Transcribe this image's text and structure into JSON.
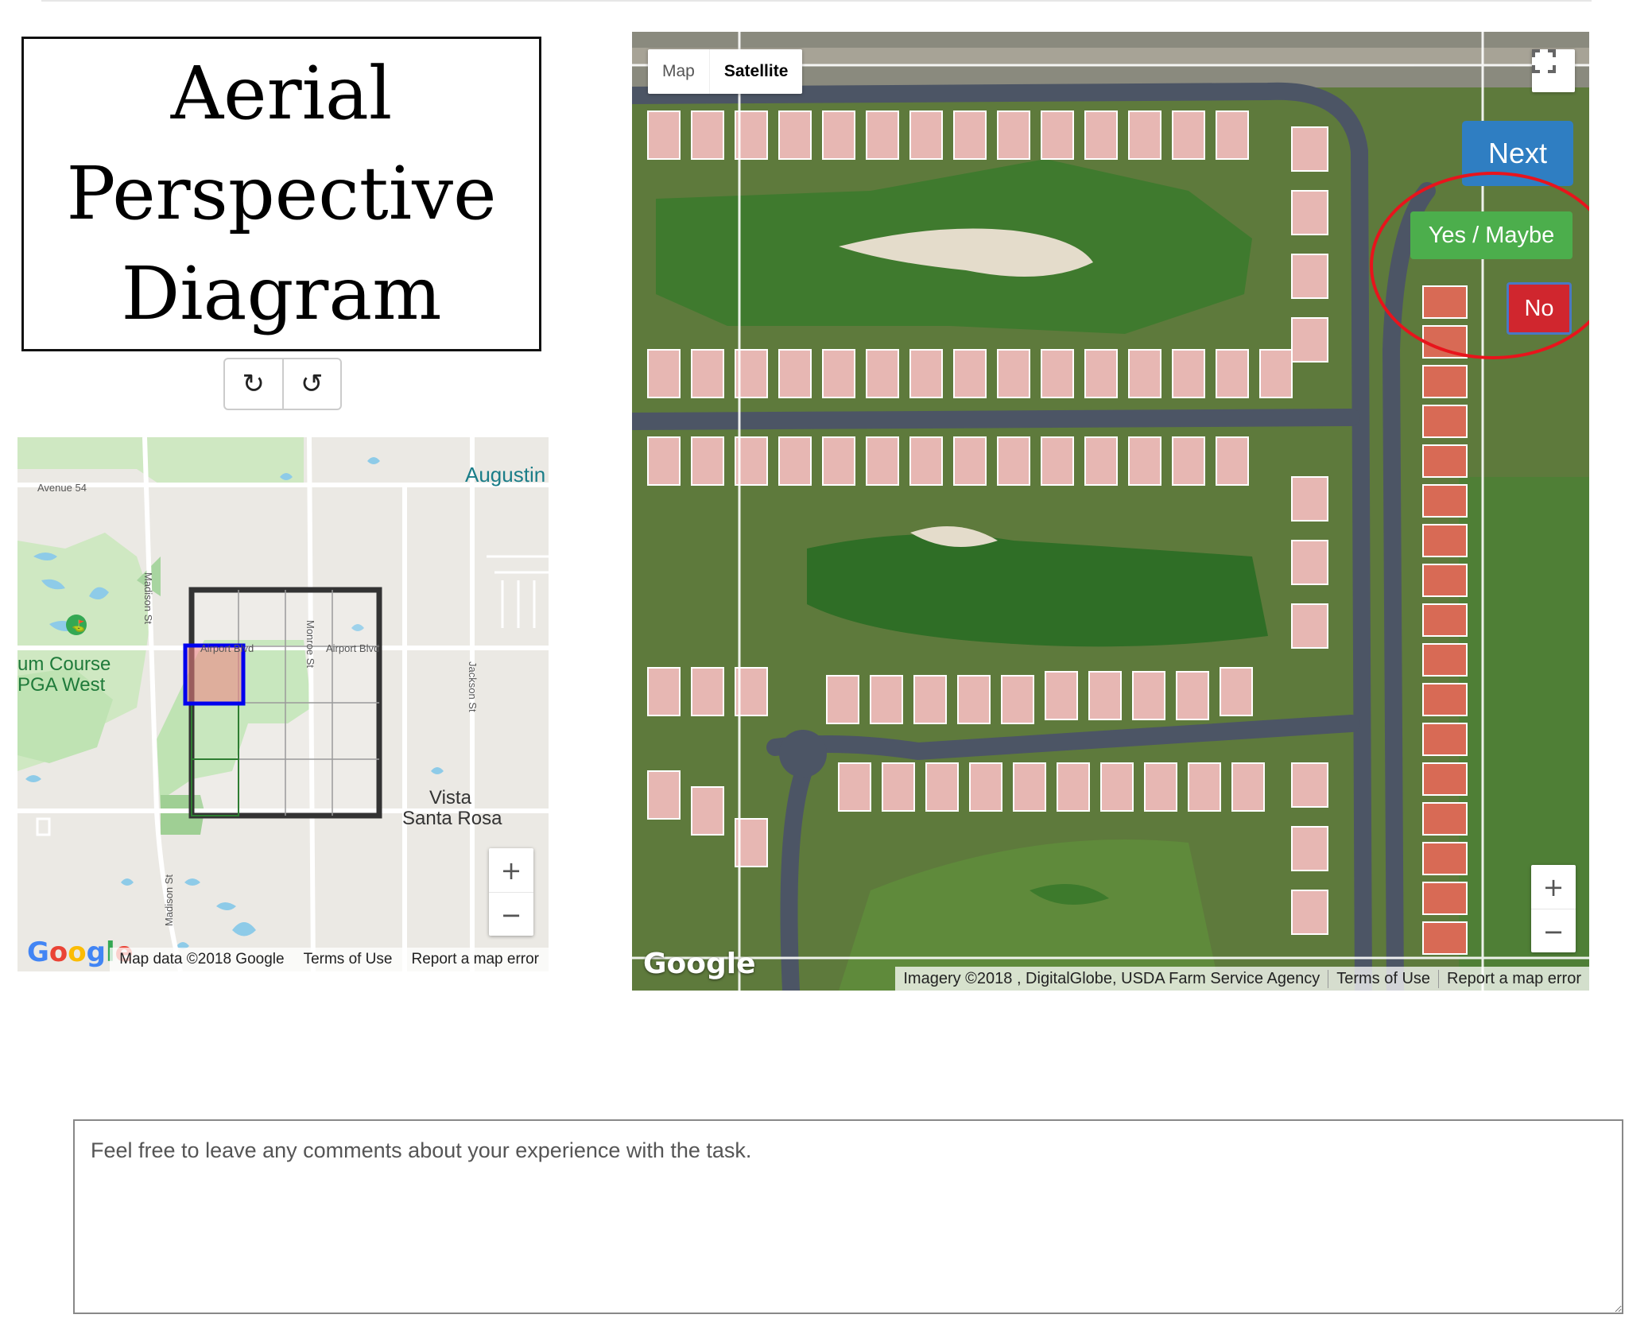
{
  "title": {
    "line1": "Aerial",
    "line2": "Perspective",
    "line3": "Diagram"
  },
  "rotate": {
    "clockwise_icon": "rotate-cw-icon",
    "counterclockwise_icon": "rotate-ccw-icon",
    "clockwise_glyph": "↻",
    "counterclockwise_glyph": "↺"
  },
  "roadmap": {
    "labels": {
      "avenue54": "Avenue 54",
      "augustine": "Augustin",
      "madison_st": "Madison St",
      "madison_st_lower": "Madison St",
      "airport_blvd_1": "Airport Blvd",
      "airport_blvd_2": "Airport Blvd",
      "monroe_st": "Monroe St",
      "jackson_st": "Jackson St",
      "course_line1": "um Course",
      "course_line2": "PGA West",
      "vista_line1": "Vista",
      "vista_line2": "Santa Rosa"
    },
    "zoom_in": "+",
    "zoom_out": "−",
    "attribution": {
      "data": "Map data ©2018 Google",
      "terms": "Terms of Use",
      "report": "Report a map error"
    },
    "logo": "Google",
    "grid": {
      "rows": 4,
      "cols": 4,
      "selected_row": 0,
      "selected_col": 0
    }
  },
  "satmap": {
    "maptype": {
      "map": "Map",
      "satellite": "Satellite"
    },
    "buttons": {
      "next": "Next",
      "yes": "Yes / Maybe",
      "no": "No"
    },
    "zoom_in": "+",
    "zoom_out": "−",
    "logo": "Google",
    "attribution": {
      "imagery": "Imagery ©2018 , DigitalGlobe, USDA Farm Service Agency",
      "terms": "Terms of Use",
      "report": "Report a map error"
    }
  },
  "comments": {
    "placeholder": "Feel free to leave any comments about your experience with the task.",
    "value": ""
  },
  "colors": {
    "next": "#2f7ec2",
    "yes": "#4cae4c",
    "no": "#d0262e",
    "highlight_ellipse": "#e8141c",
    "selected_cell": "#0000ee"
  }
}
